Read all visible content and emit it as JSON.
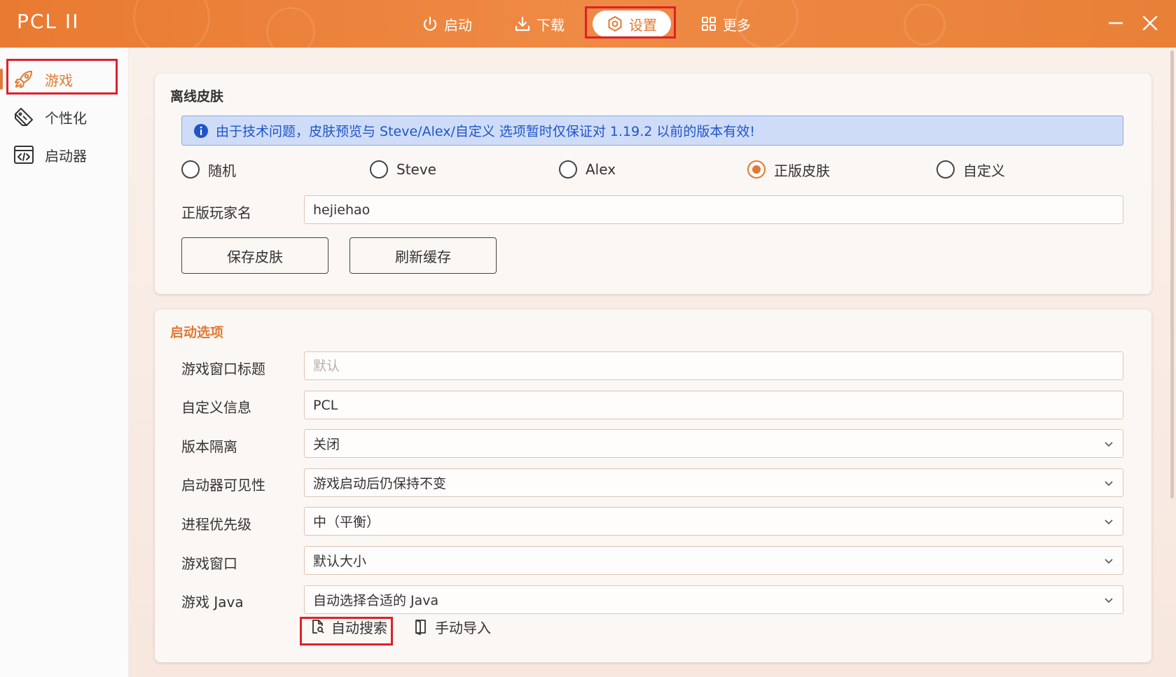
{
  "app": {
    "logo": "PCL II"
  },
  "nav": {
    "items": [
      {
        "label": "启动",
        "icon": "power-icon"
      },
      {
        "label": "下载",
        "icon": "download-icon"
      },
      {
        "label": "设置",
        "icon": "gear-icon",
        "active": true
      },
      {
        "label": "更多",
        "icon": "grid-icon"
      }
    ]
  },
  "window_controls": {
    "minimize": "minimize-icon",
    "close": "close-icon"
  },
  "sidebar": {
    "items": [
      {
        "label": "游戏",
        "icon": "rocket-icon",
        "active": true
      },
      {
        "label": "个性化",
        "icon": "palette-icon"
      },
      {
        "label": "启动器",
        "icon": "code-window-icon"
      }
    ]
  },
  "skin_card": {
    "title": "离线皮肤",
    "notice": "由于技术问题，皮肤预览与 Steve/Alex/自定义 选项暂时仅保证对 1.19.2 以前的版本有效!",
    "radios": [
      "随机",
      "Steve",
      "Alex",
      "正版皮肤",
      "自定义"
    ],
    "selected_radio": "正版皮肤",
    "player_label": "正版玩家名",
    "player_value": "hejiehao",
    "save_button": "保存皮肤",
    "refresh_button": "刷新缓存"
  },
  "launch_card": {
    "title": "启动选项",
    "window_title_label": "游戏窗口标题",
    "window_title_placeholder": "默认",
    "custom_info_label": "自定义信息",
    "custom_info_value": "PCL",
    "isolation_label": "版本隔离",
    "isolation_value": "关闭",
    "visibility_label": "启动器可见性",
    "visibility_value": "游戏启动后仍保持不变",
    "priority_label": "进程优先级",
    "priority_value": "中（平衡）",
    "window_label": "游戏窗口",
    "window_value": "默认大小",
    "java_label": "游戏 Java",
    "java_value": "自动选择合适的 Java",
    "auto_search": "自动搜索",
    "manual_import": "手动导入"
  },
  "colors": {
    "accent": "#e07a34",
    "titlebar": "#ec843e",
    "highlight_outline": "#e0202a",
    "info_text": "#1f55c8",
    "info_bg": "#cfdcf8"
  }
}
